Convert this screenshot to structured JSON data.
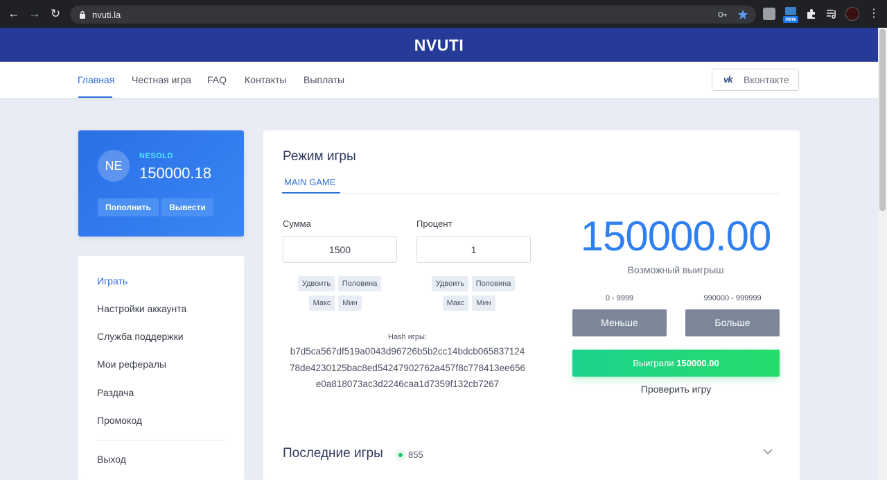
{
  "browser": {
    "url": "nvuti.la",
    "back_icon": "←",
    "forward_icon": "→",
    "reload_icon": "↻",
    "ext_badge": "new"
  },
  "header": {
    "logo": "NVUTI"
  },
  "nav": {
    "items": [
      "Главная",
      "Честная игра",
      "FAQ",
      "Контакты",
      "Выплаты"
    ],
    "vk_logo": "vk",
    "vk_label": "Вконтакте"
  },
  "profile": {
    "initials": "NE",
    "username": "NESOLD",
    "balance": "150000.18",
    "deposit_label": "Пополнить",
    "withdraw_label": "Вывести"
  },
  "sidebar": {
    "items": [
      "Играть",
      "Настройки аккаунта",
      "Служба поддержки",
      "Мои рефералы",
      "Раздача",
      "Промокод"
    ],
    "logout": "Выход"
  },
  "game": {
    "title": "Режим игры",
    "tab": "MAIN GAME",
    "amount_label": "Сумма",
    "amount_value": "1500",
    "percent_label": "Процент",
    "percent_value": "1",
    "chips": {
      "double": "Удвоить",
      "half": "Половина",
      "max": "Макс",
      "min": "Мин"
    },
    "hash_label": "Hash игры:",
    "hash_lines": [
      "b7d5ca567df519a0043d96726b5b2cc14bdcb065837124",
      "78de4230125bac8ed54247902762a457f8c778413ee656",
      "e0a818073ac3d2246caa1d7359f132cb7267"
    ],
    "possible_win": "150000.00",
    "possible_win_label": "Возможный выигрыш",
    "range_low": "0 - 9999",
    "range_high": "990000 - 999999",
    "less_label": "Меньше",
    "more_label": "Больше",
    "result_prefix": "Выиграли",
    "result_amount": "150000.00",
    "check_label": "Проверить игру"
  },
  "recent": {
    "title": "Последние игры",
    "online": "855"
  }
}
